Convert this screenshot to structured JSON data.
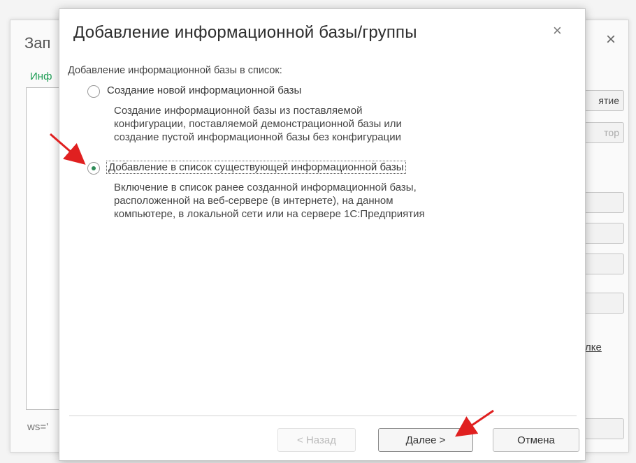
{
  "background_window": {
    "title": "Зап",
    "close_symbol": "×",
    "tab_label": "Инф",
    "status_text": "ws='",
    "buttons": [
      {
        "label": "ятие",
        "enabled": true
      },
      {
        "label": "тор",
        "enabled": false
      },
      {
        "label": "",
        "enabled": true
      },
      {
        "label": "",
        "enabled": true
      },
      {
        "label": "",
        "enabled": true
      },
      {
        "label": "",
        "enabled": true
      },
      {
        "label": "",
        "enabled": true
      }
    ],
    "link_text": "лке"
  },
  "dialog": {
    "title": "Добавление информационной базы/группы",
    "close_symbol": "×",
    "section_label": "Добавление информационной базы в список:",
    "options": [
      {
        "label": "Создание новой информационной базы",
        "selected": false,
        "description_lines": [
          "Создание информационной базы из поставляемой",
          "конфигурации, поставляемой демонстрационной базы или",
          "создание пустой информационной базы без конфигурации"
        ]
      },
      {
        "label": "Добавление в список существующей информационной базы",
        "selected": true,
        "description_lines": [
          "Включение в список ранее созданной информационной базы,",
          "расположенной на веб-сервере (в интернете), на данном",
          "компьютере,  в локальной сети или на сервере 1С:Предприятия"
        ]
      }
    ],
    "buttons": {
      "back": "< Назад",
      "next": "Далее >",
      "cancel": "Отмена"
    }
  },
  "colors": {
    "accent_green": "#2e8b57",
    "annotation_arrow": "#e02020",
    "tab_green": "#1f9d55"
  }
}
